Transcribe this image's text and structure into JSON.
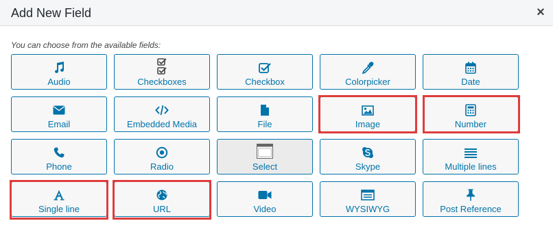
{
  "dialog": {
    "title": "Add New Field",
    "close_glyph": "×",
    "hint": "You can choose from the available fields:"
  },
  "fields": [
    {
      "label": "Audio",
      "icon": "music-note-icon",
      "highlighted": false
    },
    {
      "label": "Checkboxes",
      "icon": "checkboxes-icon",
      "highlighted": false
    },
    {
      "label": "Checkbox",
      "icon": "checkbox-icon",
      "highlighted": false
    },
    {
      "label": "Colorpicker",
      "icon": "eyedropper-icon",
      "highlighted": false
    },
    {
      "label": "Date",
      "icon": "calendar-icon",
      "highlighted": false
    },
    {
      "label": "Email",
      "icon": "envelope-icon",
      "highlighted": false
    },
    {
      "label": "Embedded Media",
      "icon": "code-icon",
      "highlighted": false
    },
    {
      "label": "File",
      "icon": "file-icon",
      "highlighted": false
    },
    {
      "label": "Image",
      "icon": "image-icon",
      "highlighted": true
    },
    {
      "label": "Number",
      "icon": "calculator-icon",
      "highlighted": true
    },
    {
      "label": "Phone",
      "icon": "phone-icon",
      "highlighted": false
    },
    {
      "label": "Radio",
      "icon": "radio-icon",
      "highlighted": false
    },
    {
      "label": "Select",
      "icon": "select-box-icon",
      "highlighted": false,
      "inactive": true
    },
    {
      "label": "Skype",
      "icon": "skype-icon",
      "highlighted": false
    },
    {
      "label": "Multiple lines",
      "icon": "lines-icon",
      "highlighted": false
    },
    {
      "label": "Single line",
      "icon": "font-a-icon",
      "highlighted": true
    },
    {
      "label": "URL",
      "icon": "globe-icon",
      "highlighted": true
    },
    {
      "label": "Video",
      "icon": "video-camera-icon",
      "highlighted": false
    },
    {
      "label": "WYSIWYG",
      "icon": "editor-window-icon",
      "highlighted": false
    },
    {
      "label": "Post Reference",
      "icon": "pin-icon",
      "highlighted": false
    }
  ],
  "colors": {
    "accent": "#0073aa",
    "highlight": "#e03c3c",
    "tile_bg": "#f7f7f7",
    "header_bg": "#f5f6f7"
  }
}
